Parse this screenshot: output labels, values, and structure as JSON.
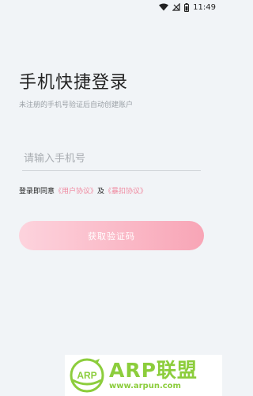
{
  "status_bar": {
    "time": "11:49",
    "icons": [
      "wifi-icon",
      "no-signal-icon",
      "battery-icon"
    ]
  },
  "login": {
    "title": "手机快捷登录",
    "subtitle": "未注册的手机号验证后自动创建账户",
    "phone_placeholder": "请输入手机号",
    "phone_value": "",
    "agreement_prefix": "登录即同意",
    "user_agreement_link": "《用户协议》",
    "agreement_and": "及",
    "deduction_agreement_link": "《暴扣协议》",
    "get_code_button": "获取验证码"
  },
  "watermark": {
    "logo_text": "ARP",
    "main_text": "ARP联盟",
    "url_text": "www.arpun.com"
  },
  "colors": {
    "background": "#f1f4f7",
    "link": "#f08aa0",
    "button_gradient_start": "#fdd3dd",
    "button_gradient_end": "#f8a5b6",
    "watermark_green": "#8ccd3c"
  }
}
